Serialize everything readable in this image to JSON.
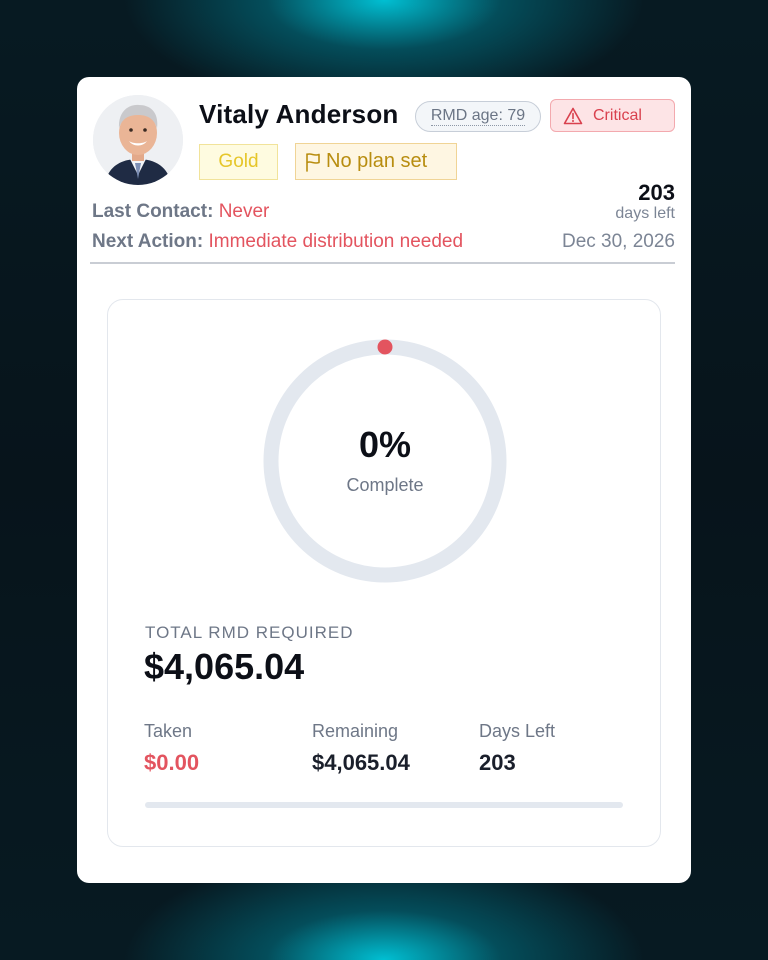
{
  "client": {
    "name": "Vitaly Anderson",
    "age_badge": "RMD age: 79",
    "status_badge": "Critical",
    "tier": "Gold",
    "plan": "No plan set"
  },
  "contact": {
    "last_contact_label": "Last Contact:",
    "last_contact_value": "Never",
    "next_action_label": "Next Action:",
    "next_action_value": "Immediate distribution needed",
    "days_left_number": "203",
    "days_left_text": "days left",
    "deadline": "Dec 30, 2026"
  },
  "progress": {
    "percent_text": "0%",
    "percent_value": 0,
    "complete_label": "Complete",
    "total_label": "TOTAL RMD REQUIRED",
    "total_value": "$4,065.04",
    "stats": [
      {
        "label": "Taken",
        "value": "$0.00"
      },
      {
        "label": "Remaining",
        "value": "$4,065.04"
      },
      {
        "label": "Days Left",
        "value": "203"
      }
    ]
  },
  "colors": {
    "critical": "#e3545f",
    "gold": "#e6c62a",
    "ring_track": "#e3e8ef"
  }
}
